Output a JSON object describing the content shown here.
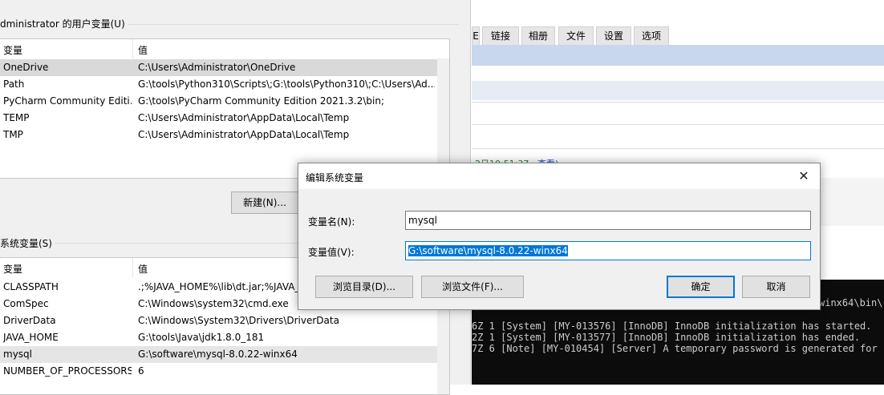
{
  "user_vars": {
    "group_label": "dministrator 的用户变量(U)",
    "col_name": "变量",
    "col_value": "值",
    "rows": [
      {
        "name": "OneDrive",
        "value": "C:\\Users\\Administrator\\OneDrive"
      },
      {
        "name": "Path",
        "value": "G:\\tools\\Python310\\Scripts\\;G:\\tools\\Python310\\;C:\\Users\\Ad..."
      },
      {
        "name": "PyCharm Community Editi...",
        "value": "G:\\tools\\PyCharm Community Edition 2021.3.2\\bin;"
      },
      {
        "name": "TEMP",
        "value": "C:\\Users\\Administrator\\AppData\\Local\\Temp"
      },
      {
        "name": "TMP",
        "value": "C:\\Users\\Administrator\\AppData\\Local\\Temp"
      }
    ],
    "new_button": "新建(N)..."
  },
  "system_vars": {
    "group_label": "系统变量(S)",
    "col_name": "变量",
    "col_value": "值",
    "rows": [
      {
        "name": "CLASSPATH",
        "value": ".;%JAVA_HOME%\\lib\\dt.jar;%JAVA_"
      },
      {
        "name": "ComSpec",
        "value": "C:\\Windows\\system32\\cmd.exe"
      },
      {
        "name": "DriverData",
        "value": "C:\\Windows\\System32\\Drivers\\DriverData"
      },
      {
        "name": "JAVA_HOME",
        "value": "G:\\tools\\Java\\jdk1.8.0_181"
      },
      {
        "name": "mysql",
        "value": "G:\\software\\mysql-8.0.22-winx64"
      },
      {
        "name": "NUMBER_OF_PROCESSORS",
        "value": "6"
      }
    ]
  },
  "dialog": {
    "title": "编辑系统变量",
    "close_glyph": "✕",
    "name_label": "变量名(N):",
    "name_value": "mysql",
    "value_label": "变量值(V):",
    "value_value": "G:\\software\\mysql-8.0.22-winx64",
    "browse_dir": "浏览目录(D)...",
    "browse_file": "浏览文件(F)...",
    "ok": "确定",
    "cancel": "取消",
    "accent": "#0078d7"
  },
  "background_page": {
    "tabs": [
      "链接",
      "相册",
      "文件",
      "设置",
      "选项"
    ],
    "partial_tab": "E",
    "timestamp_text": "2日10:51:37",
    "view_link": "查看)",
    "console_lines": [
      "winx64\\bin\\",
      "6Z 1 [System] [MY-013576] [InnoDB] InnoDB initialization has started.",
      "2Z 1 [System] [MY-013577] [InnoDB] InnoDB initialization has ended.",
      "7Z 6 [Note] [MY-010454] [Server] A temporary password is generated for r"
    ]
  }
}
